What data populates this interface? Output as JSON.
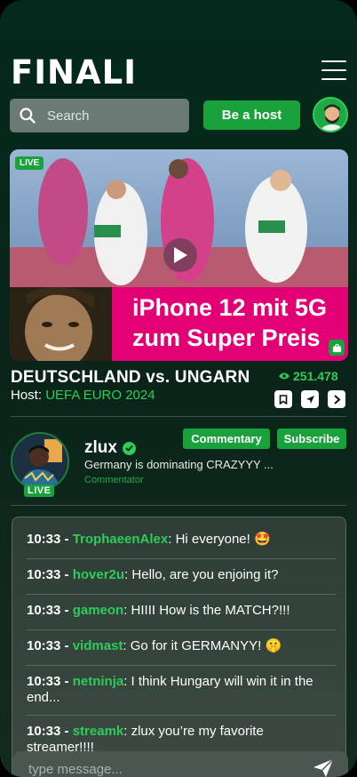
{
  "header": {
    "logo": "FINALI",
    "search_placeholder": "Search",
    "host_button": "Be a host"
  },
  "video": {
    "live_label": "LIVE",
    "ad_text_line1": "iPhone 12 mit 5G",
    "ad_text_line2": "zum Super Preis"
  },
  "match": {
    "title": "DEUTSCHLAND vs. UNGARN",
    "viewers": "251.478",
    "host_label": "Host:",
    "host_name": "UEFA EURO 2024"
  },
  "streamer": {
    "name": "zlux",
    "status": "Germany is dominating CRAZYYY ...",
    "role": "Commentator",
    "live_label": "LIVE",
    "commentary_button": "Commentary",
    "subscribe_button": "Subscribe"
  },
  "chat": {
    "messages": [
      {
        "time": "10:33 -",
        "user": "TrophaeenAlex",
        "text": " Hi everyone! 🤩"
      },
      {
        "time": "10:33 -",
        "user": "hover2u",
        "text": " Hello, are you enjoing it?"
      },
      {
        "time": "10:33 -",
        "user": "gameon",
        "text": " HIIII How is the MATCH?!!!"
      },
      {
        "time": "10:33 -",
        "user": "vidmast",
        "text": " Go for it GERMANYY! 🤫"
      },
      {
        "time": "10:33 -",
        "user": "netninja",
        "text": " I think Hungary will win it in the end..."
      },
      {
        "time": "10:33 -",
        "user": "streamk",
        "text": " zlux you’re my favorite streamer!!!!"
      }
    ],
    "input_placeholder": "type message..."
  },
  "colors": {
    "accent": "#19a23c",
    "accent_text": "#2ecc5a",
    "ad_magenta": "#e20074",
    "background": "#0a2419"
  },
  "icons": [
    "menu-icon",
    "search-icon",
    "play-icon",
    "eye-icon",
    "bookmark-icon",
    "share-icon",
    "chevron-right-icon",
    "verified-icon",
    "send-icon",
    "shopping-bag-icon"
  ]
}
